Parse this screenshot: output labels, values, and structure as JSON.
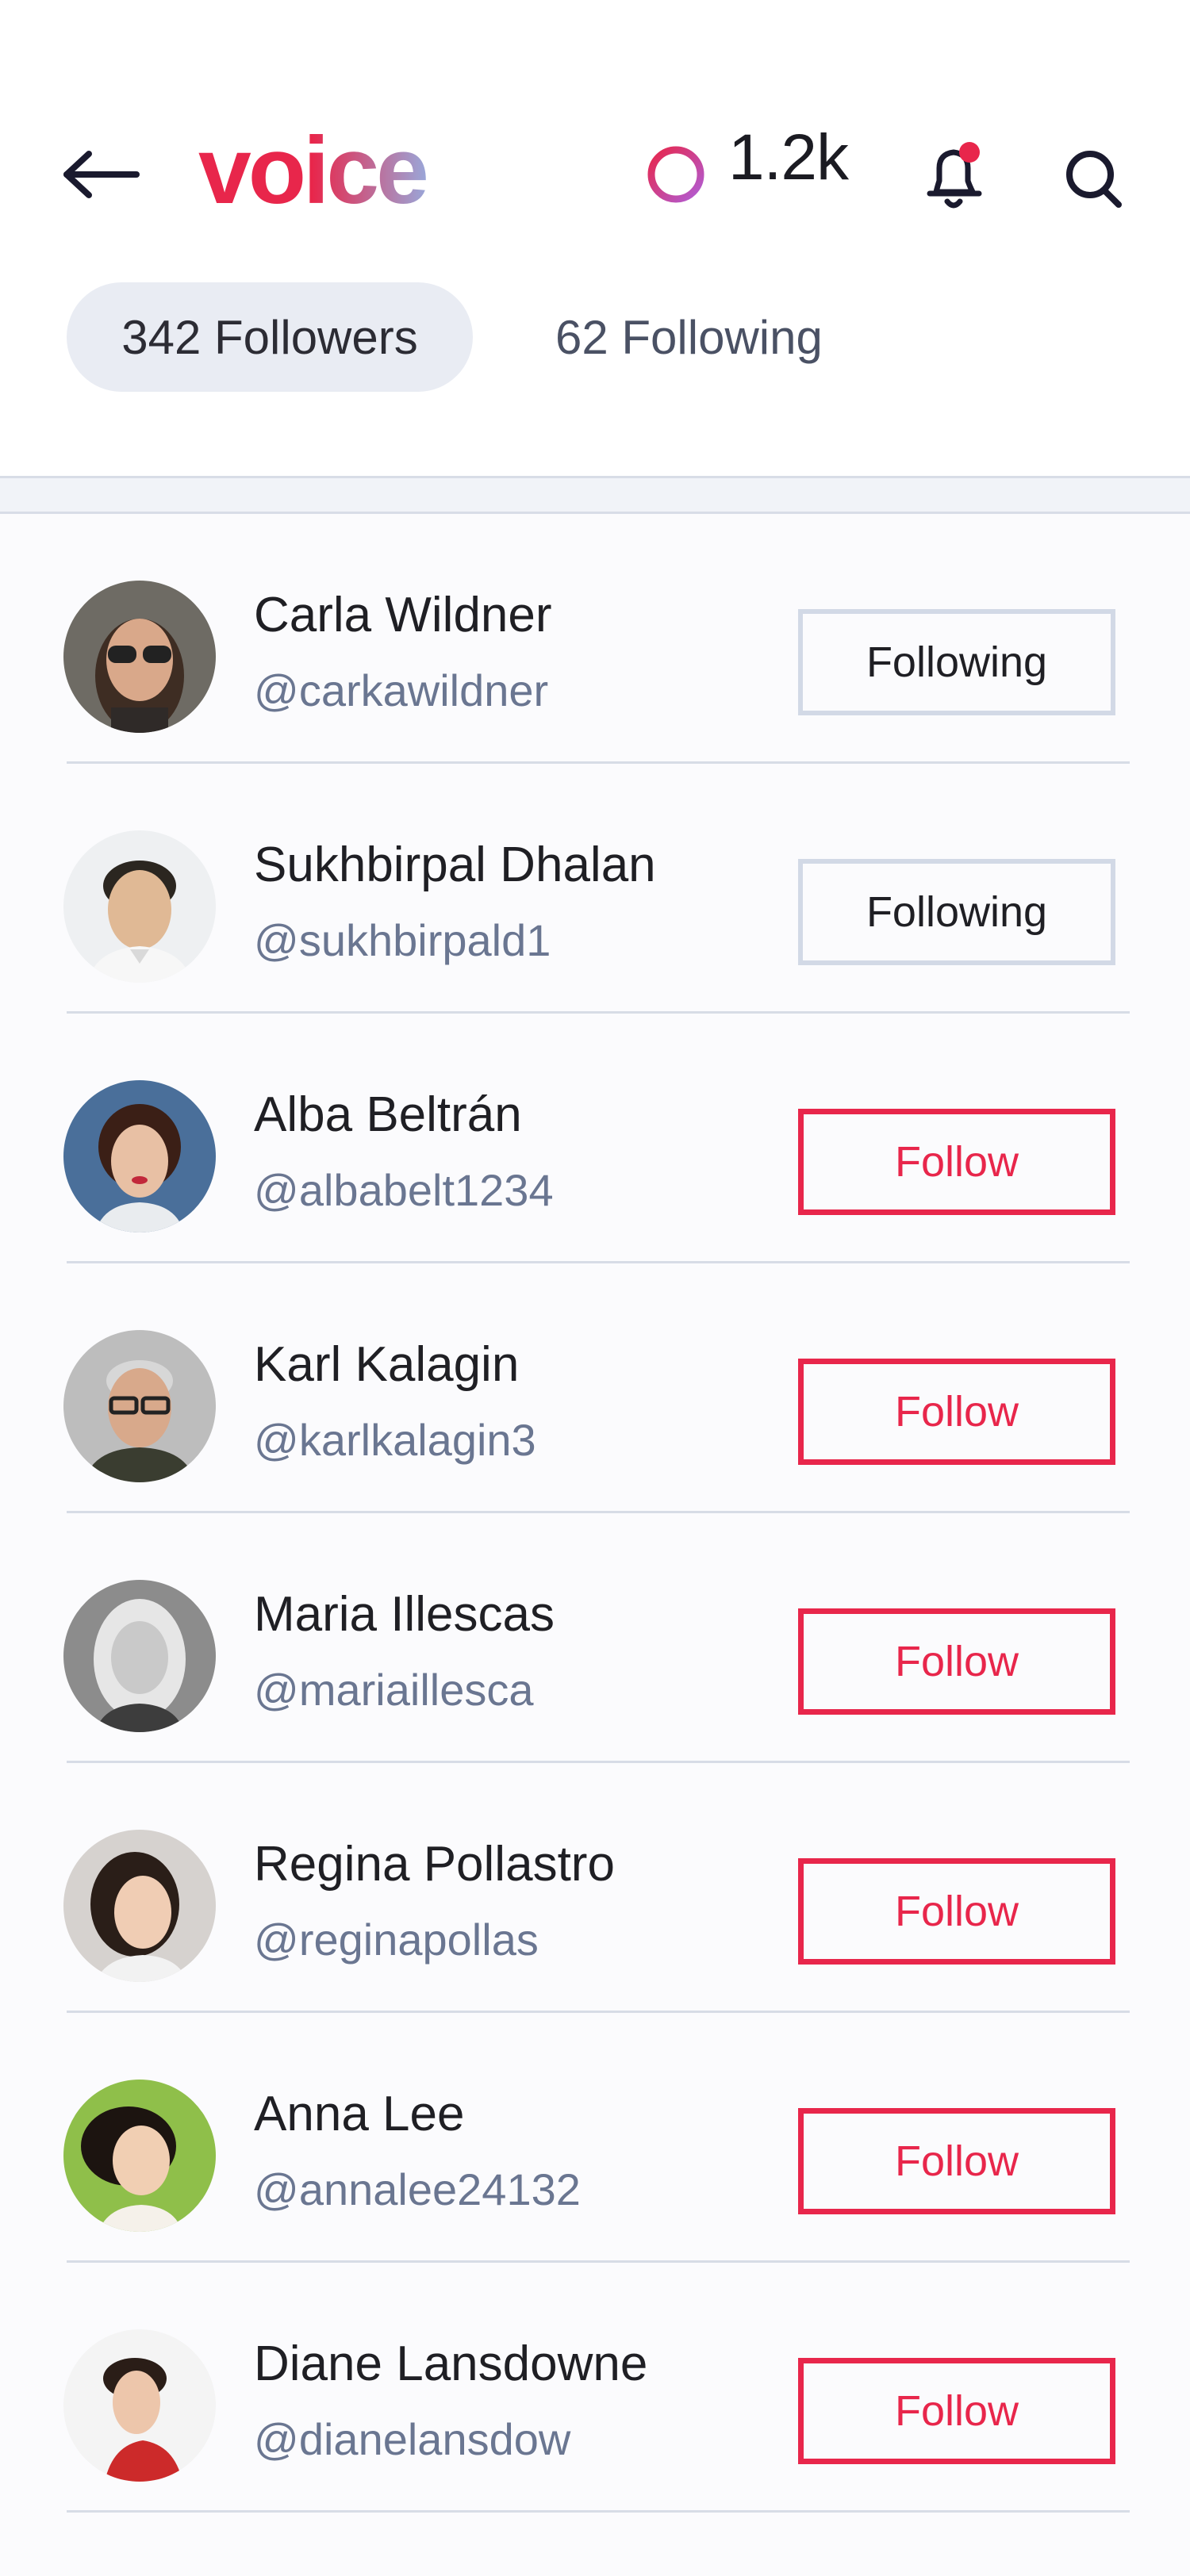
{
  "header": {
    "logo_text": "voice",
    "coin_count": "1.2k",
    "has_notification": true
  },
  "tabs": [
    {
      "label": "342 Followers",
      "active": true
    },
    {
      "label": "62 Following",
      "active": false
    }
  ],
  "colors": {
    "accent": "#e8264b",
    "muted_text": "#6a7691",
    "divider": "#d7dce6"
  },
  "users": [
    {
      "name": "Carla Wildner",
      "handle": "@carkawildner",
      "button": "Following",
      "status": "following"
    },
    {
      "name": "Sukhbirpal Dhalan",
      "handle": "@sukhbirpald1",
      "button": "Following",
      "status": "following"
    },
    {
      "name": "Alba Beltrán",
      "handle": "@albabelt1234",
      "button": "Follow",
      "status": "follow"
    },
    {
      "name": "Karl Kalagin",
      "handle": "@karlkalagin3",
      "button": "Follow",
      "status": "follow"
    },
    {
      "name": "Maria Illescas",
      "handle": "@mariaillesca",
      "button": "Follow",
      "status": "follow"
    },
    {
      "name": "Regina Pollastro",
      "handle": "@reginapollas",
      "button": "Follow",
      "status": "follow"
    },
    {
      "name": "Anna Lee",
      "handle": "@annalee24132",
      "button": "Follow",
      "status": "follow"
    },
    {
      "name": "Diane Lansdowne",
      "handle": "@dianelansdow",
      "button": "Follow",
      "status": "follow"
    }
  ]
}
